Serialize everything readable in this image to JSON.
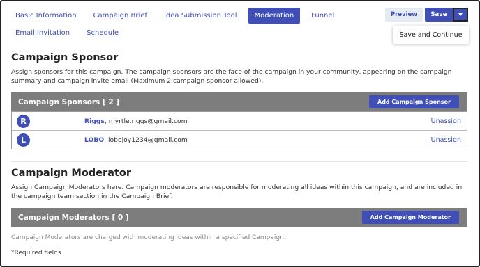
{
  "tabs": {
    "row1": [
      "Basic Information",
      "Campaign Brief",
      "Idea Submission Tool",
      "Moderation",
      "Funnel"
    ],
    "row2": [
      "Email Invitation",
      "Schedule"
    ],
    "active": "Moderation"
  },
  "toolbar": {
    "preview_label": "Preview",
    "save_label": "Save",
    "dropdown_item": "Save and Continue"
  },
  "sponsor_section": {
    "title": "Campaign Sponsor",
    "description": "Assign sponsors for this campaign. The campaign sponsors are the face of the campaign in your community, appearing on the campaign summary and campaign invite email (Maximum 2 campaign sponsor allowed).",
    "bar_title": "Campaign Sponsors [ 2 ]",
    "add_label": "Add Campaign Sponsor",
    "sponsors": [
      {
        "initial": "R",
        "name": "Riggs",
        "email": ", myrtle.riggs@gmail.com",
        "action": "Unassign"
      },
      {
        "initial": "L",
        "name": "LOBO",
        "email": ", lobojoy1234@gmail.com",
        "action": "Unassign"
      }
    ]
  },
  "moderator_section": {
    "title": "Campaign Moderator",
    "description": "Assign Campaign Moderators here. Campaign moderators are responsible for moderating all ideas within this campaign, and are included in the campaign team section in the Campaign Brief.",
    "bar_title": "Campaign Moderators [ 0 ]",
    "add_label": "Add Campaign Moderator",
    "note": "Campaign Moderators are charged with moderating ideas within a specified Campaign."
  },
  "footer": {
    "required_label": "*Required fields"
  },
  "colors": {
    "accent": "#3f4fb5",
    "bar": "#7d7d7d",
    "preview_bg": "#e6ebf2"
  }
}
